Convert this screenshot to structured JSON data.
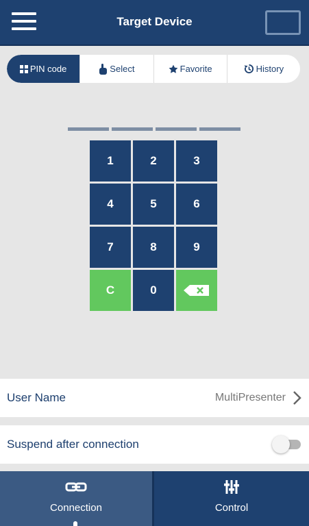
{
  "header": {
    "title": "Target Device"
  },
  "tabs": [
    {
      "label": "PIN code",
      "icon": "grid-icon",
      "active": true
    },
    {
      "label": "Select",
      "icon": "hand-pointer-icon",
      "active": false
    },
    {
      "label": "Favorite",
      "icon": "star-icon",
      "active": false
    },
    {
      "label": "History",
      "icon": "history-icon",
      "active": false
    }
  ],
  "pin": {
    "digits_entered": 0,
    "slots": 4
  },
  "keypad": {
    "keys": [
      "1",
      "2",
      "3",
      "4",
      "5",
      "6",
      "7",
      "8",
      "9",
      "C",
      "0",
      "backspace"
    ]
  },
  "settings": {
    "user_name_label": "User Name",
    "user_name_value": "MultiPresenter",
    "suspend_label": "Suspend after connection",
    "suspend_enabled": false
  },
  "bottom_nav": {
    "connection_label": "Connection",
    "control_label": "Control"
  },
  "colors": {
    "primary": "#1e4170",
    "accent_green": "#62c85e",
    "background": "#e6e6e6"
  }
}
